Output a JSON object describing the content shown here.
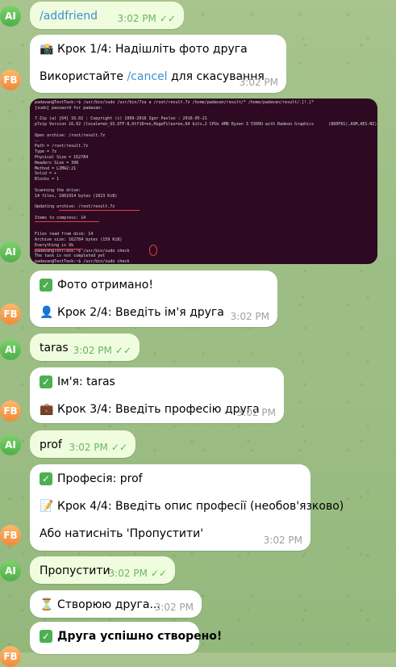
{
  "messages": [
    {
      "id": "m1",
      "text": "/addfriend",
      "time": "3:02 PM"
    },
    {
      "id": "m2",
      "line1": "Крок 1/4: Надішліть фото друга",
      "line2_pre": "Використайте ",
      "line2_cmd": "/cancel",
      "line2_post": " для скасування",
      "time": "3:02 PM"
    },
    {
      "id": "m3",
      "terminal": "padavan@TestTask:~$ /usr/bin/sudo /usr/bin/7za a /root/result.7z /home/padavan/result/* /home/padavan/result/.[!.]*\n[sudo] password for padavan:\n\n7-Zip (a) [64] 16.02 : Copyright (c) 1999-2016 Igor Pavlov : 2016-05-21\np7zip Version 16.02 (locale=en_US.UTF-8,Utf16=on,HugeFiles=on,64 bits,2 CPUs AMD Ryzen 3 5300U with Radeon Graphics      (860F81),ASM,AES-NI)\n\nOpen archive: /root/result.7z\n--\nPath = /root/result.7z\nType = 7z\nPhysical Size = 162784\nHeaders Size = 398\nMethod = LZMA2:21\nSolid = +\nBlocks = 1\n\nScanning the drive:\n14 files, 1061914 bytes (1023 KiB)\n\nUpdating archive: /root/result.7z\n\nItems to compress: 14\n\n\nFiles read from disk: 14\nArchive size: 162784 bytes (159 KiB)\nEverything is Ok\npadavan@TestTask:~$ /usr/bin/sudo check\nThe task is not completed yet\npadavan@TestTask:~$ /usr/bin/sudo check\n[sudo] password for padavan:\nThe task is not completed yet"
    },
    {
      "id": "m4",
      "line1": "Фото отримано!",
      "line2": "Крок 2/4: Введіть ім'я друга",
      "time": "3:02 PM"
    },
    {
      "id": "m5",
      "text": "taras",
      "time": "3:02 PM"
    },
    {
      "id": "m6",
      "line1": "Ім'я: taras",
      "line2": "Крок 3/4: Введіть професію друга",
      "time": "3:02 PM"
    },
    {
      "id": "m7",
      "text": "prof",
      "time": "3:02 PM"
    },
    {
      "id": "m8",
      "line1": "Професія: prof",
      "line2": "Крок 4/4: Введіть опис професії (необов'язково)",
      "line3": "Або натисніть 'Пропустити'",
      "time": "3:02 PM"
    },
    {
      "id": "m9",
      "text": "Пропустити",
      "time": "3:02 PM"
    },
    {
      "id": "m10",
      "text": "Створюю друга...",
      "time": "3:02 PM"
    },
    {
      "id": "m11",
      "text": "Друга успішно створено!"
    }
  ],
  "avatars": {
    "ai": "AI",
    "fb": "FB"
  },
  "colors": {
    "ai_avatar": "#4fae4a",
    "fb_avatar": "#f08a3a",
    "outgoing_bubble": "#effdde",
    "link": "#3d8fd1"
  }
}
